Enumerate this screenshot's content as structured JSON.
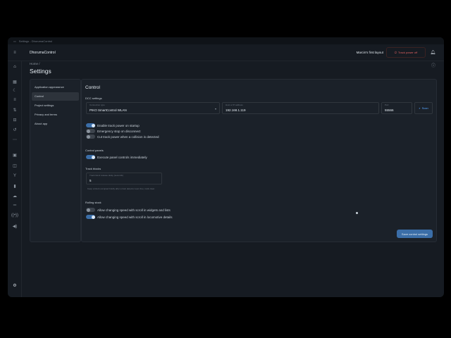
{
  "window_title": "Settings - DhorumaControl",
  "app": {
    "name": "DhorumaControl",
    "layout_name": "Marcin's first layout",
    "power_button": "Track power off"
  },
  "breadcrumb": "Home  /",
  "page_title": "Settings",
  "subnav": {
    "items": [
      {
        "label": "Application appearance"
      },
      {
        "label": "Control"
      },
      {
        "label": "Project settings"
      },
      {
        "label": "Privacy and terms"
      },
      {
        "label": "About app"
      }
    ],
    "active_index": 1
  },
  "control": {
    "title": "Control",
    "dcc": {
      "heading": "DCC settings",
      "connection_type_label": "Connection type",
      "connection_type_value": "PIKO SmartControl WLAN",
      "host_label": "Host or IP address",
      "host_value": "192.168.1.119",
      "port_label": "Port",
      "port_value": "55566",
      "scan_label": "Scan"
    },
    "toggles": [
      {
        "label": "Enable track power on startup",
        "on": true
      },
      {
        "label": "Emergency stop on disconnect",
        "on": false
      },
      {
        "label": "Cut track power when a collision is detected",
        "on": false
      }
    ],
    "control_panels": {
      "heading": "Control panels",
      "toggle": {
        "label": "Execute panel controls immediately",
        "on": true
      }
    },
    "track_blocks": {
      "heading": "Track blocks",
      "field_label": "Track block release delay (seconds)",
      "field_value": "5",
      "helper": "Keep a block occupied briefly after a train detector went free, trails clear."
    },
    "rolling_stock": {
      "heading": "Rolling stock",
      "toggles": [
        {
          "label": "Allow changing speed with scroll in widgets and lists",
          "on": false
        },
        {
          "label": "Allow changing speed with scroll in locomotive details",
          "on": true
        }
      ]
    },
    "save_label": "Save control settings"
  },
  "colors": {
    "accent": "#3b6ea8",
    "danger": "#e06060",
    "background": "#161b22",
    "panel": "#1b2129"
  },
  "icons": {
    "menu": "menu-icon",
    "bell": "bell-icon",
    "power": "power-icon",
    "help": "help-icon",
    "scan": "search-icon",
    "settings": "gear-icon"
  }
}
